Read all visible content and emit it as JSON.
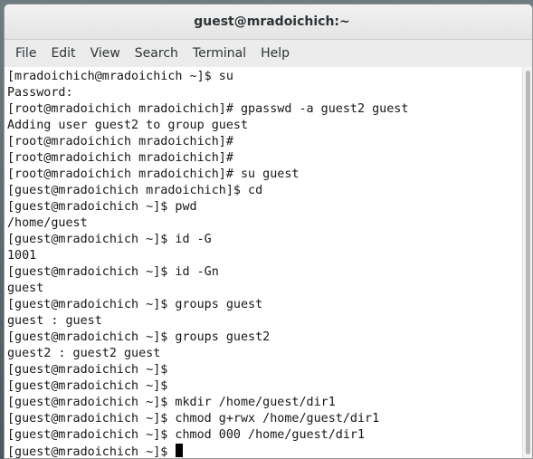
{
  "window": {
    "title": "guest@mradoichich:~"
  },
  "menubar": {
    "items": [
      "File",
      "Edit",
      "View",
      "Search",
      "Terminal",
      "Help"
    ]
  },
  "terminal": {
    "lines": [
      "[mradoichich@mradoichich ~]$ su",
      "Password:",
      "[root@mradoichich mradoichich]# gpasswd -a guest2 guest",
      "Adding user guest2 to group guest",
      "[root@mradoichich mradoichich]#",
      "[root@mradoichich mradoichich]#",
      "[root@mradoichich mradoichich]# su guest",
      "[guest@mradoichich mradoichich]$ cd",
      "[guest@mradoichich ~]$ pwd",
      "/home/guest",
      "[guest@mradoichich ~]$ id -G",
      "1001",
      "[guest@mradoichich ~]$ id -Gn",
      "guest",
      "[guest@mradoichich ~]$ groups guest",
      "guest : guest",
      "[guest@mradoichich ~]$ groups guest2",
      "guest2 : guest2 guest",
      "[guest@mradoichich ~]$",
      "[guest@mradoichich ~]$",
      "[guest@mradoichich ~]$ mkdir /home/guest/dir1",
      "[guest@mradoichich ~]$ chmod g+rwx /home/guest/dir1",
      "[guest@mradoichich ~]$ chmod 000 /home/guest/dir1"
    ],
    "prompt_line": "[guest@mradoichich ~]$ "
  }
}
